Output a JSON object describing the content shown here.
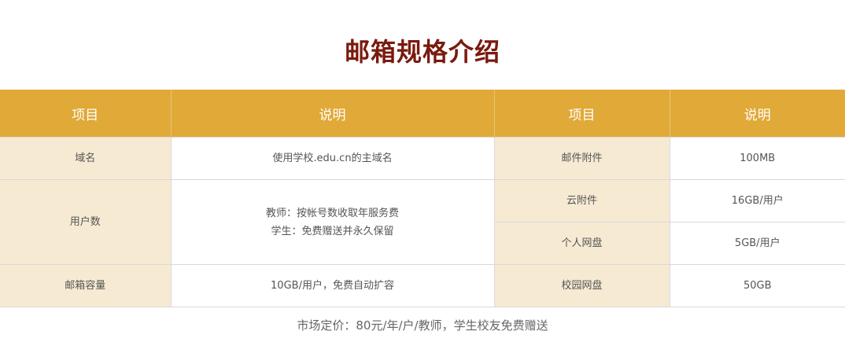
{
  "title": "邮箱规格介绍",
  "table": {
    "headers": [
      "项目",
      "说明",
      "项目",
      "说明"
    ],
    "rows": {
      "domain": {
        "label": "域名",
        "value": "使用学校.edu.cn的主域名"
      },
      "users": {
        "label": "用户数",
        "value_lines": [
          "教师：按帐号数收取年服务费",
          "学生：免费赠送并永久保留"
        ]
      },
      "capacity": {
        "label": "邮箱容量",
        "value": "10GB/用户，免费自动扩容"
      },
      "attachment": {
        "label": "邮件附件",
        "value": "100MB"
      },
      "cloud_attachment": {
        "label": "云附件",
        "value": "16GB/用户"
      },
      "personal_disk": {
        "label": "个人网盘",
        "value": "5GB/用户"
      },
      "campus_disk": {
        "label": "校园网盘",
        "value": "50GB"
      }
    }
  },
  "footer": "市场定价：80元/年/户/教师，学生校友免费赠送"
}
